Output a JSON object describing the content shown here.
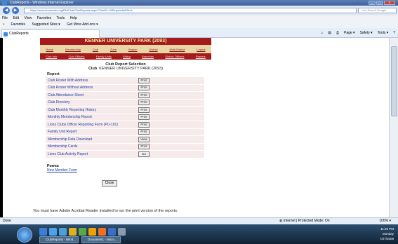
{
  "window": {
    "title": "ClubReports - Windows Internet Explorer",
    "min": "_",
    "max": "□",
    "close": "X"
  },
  "address": {
    "url": "https://www.lionsclubs.org/EN/Club/ClubReports.aspx?ClubID=1&ReportsAsPId=k",
    "search_placeholder": "Live Search Google"
  },
  "menu": [
    "File",
    "Edit",
    "View",
    "Favorites",
    "Tools",
    "Help"
  ],
  "favbar": {
    "favorites": "Favorites",
    "suggested": "Suggested Sites ▾",
    "addons": "Get More Add-ons ▾"
  },
  "tab": {
    "label": "ClubReports"
  },
  "toolbar": {
    "page": "Page ▾",
    "safety": "Safety ▾",
    "tools": "Tools ▾"
  },
  "site": {
    "banner": "KENNER UNIVERSITY PARK (2093)",
    "nav": [
      "Home",
      "Membership",
      "Club",
      "Zone",
      "Region",
      "District",
      "Multi-District",
      "Logout"
    ],
    "subnav": [
      "Club Info",
      "Club Officers",
      "Family Units",
      "Billing",
      "Branches",
      "District Officers",
      "Reports"
    ]
  },
  "report": {
    "heading": "Club Report Selection",
    "club_label": "Club",
    "club_value": "KENNER UNIVERSITY PARK (2093)",
    "section": "Report",
    "rows": [
      {
        "label": "Club Roster With Address",
        "action": "Print"
      },
      {
        "label": "Club Roster Without Address",
        "action": "Print"
      },
      {
        "label": "Club Attendance Sheet",
        "action": "Print"
      },
      {
        "label": "Club Directory",
        "action": "Print"
      },
      {
        "label": "Club Monthly Reporting History",
        "action": "Print"
      },
      {
        "label": "Monthly Membership Report",
        "action": "Print"
      },
      {
        "label": "Lions Clubs Officer Reporting Form (PU-101)",
        "action": "Print"
      },
      {
        "label": "Family Unit Report",
        "action": "Print"
      },
      {
        "label": "Membership Data Download",
        "action": "View"
      },
      {
        "label": "Membership Cards",
        "action": "Print"
      },
      {
        "label": "Lions Club Activity Report",
        "action": "Go"
      }
    ],
    "forms_heading": "Forms",
    "forms_link": "New Member Form",
    "close": "Close",
    "note": "You must have Adobe Acrobat Reader installed to run the print version of the reports."
  },
  "status": {
    "left": "Done",
    "zone": "Internet | Protected Mode: On",
    "zoom": "100% ▾"
  },
  "taskbar": {
    "buttons": [
      "ClubReports - Wind...",
      "Document1 - Micro..."
    ],
    "time": "11:26 PM",
    "day": "Monday",
    "date": "7/27/2009"
  }
}
